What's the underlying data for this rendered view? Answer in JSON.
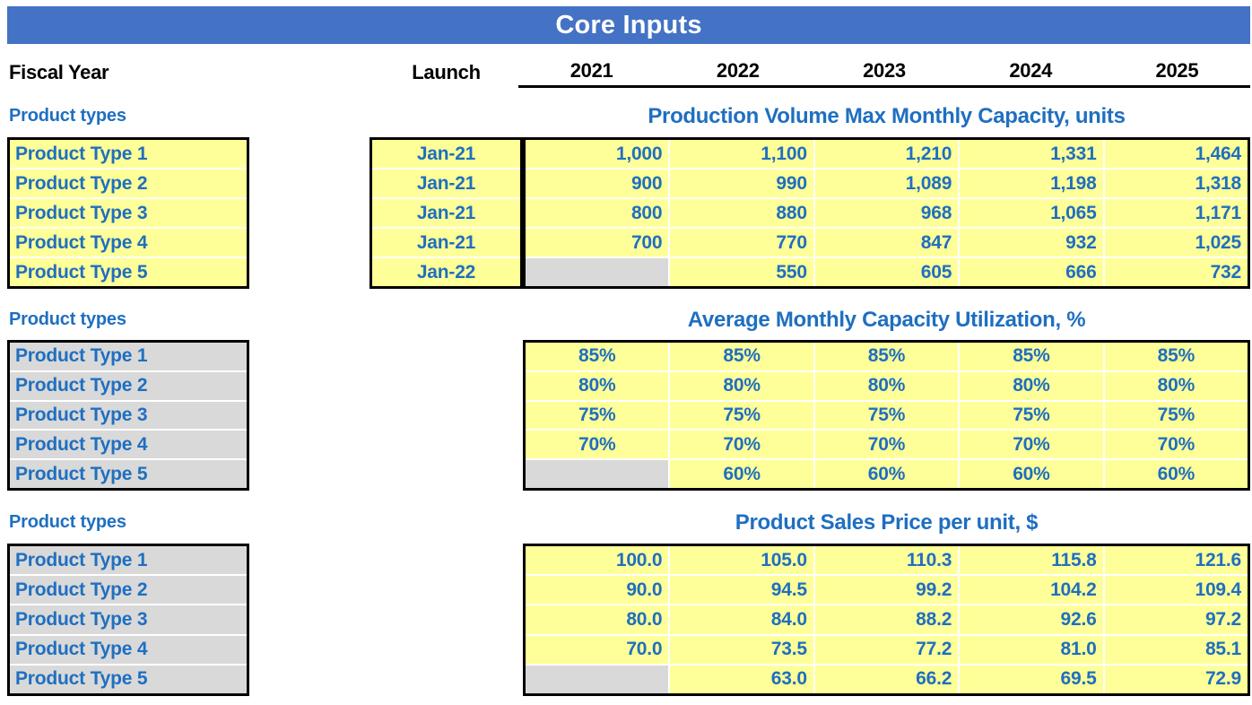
{
  "banner": {
    "title": "Core Inputs"
  },
  "header": {
    "fiscal_year_label": "Fiscal Year",
    "launch_label": "Launch",
    "years": [
      "2021",
      "2022",
      "2023",
      "2024",
      "2025"
    ]
  },
  "colors": {
    "banner_blue": "#4472C4",
    "text_blue": "#1F6FC0",
    "input_yellow": "#FFFF99",
    "locked_gray": "#D9D9D9"
  },
  "product_types": [
    "Product Type 1",
    "Product Type 2",
    "Product Type 3",
    "Product Type 4",
    "Product Type 5"
  ],
  "sections": [
    {
      "left_title": "Product types",
      "title": "Production Volume Max Monthly Capacity, units",
      "names_fill": "yellow",
      "align": "right",
      "launch": [
        "Jan-21",
        "Jan-21",
        "Jan-21",
        "Jan-21",
        "Jan-22"
      ],
      "rows": [
        [
          "1,000",
          "1,100",
          "1,210",
          "1,331",
          "1,464"
        ],
        [
          "900",
          "990",
          "1,089",
          "1,198",
          "1,318"
        ],
        [
          "800",
          "880",
          "968",
          "1,065",
          "1,171"
        ],
        [
          "700",
          "770",
          "847",
          "932",
          "1,025"
        ],
        [
          "",
          "550",
          "605",
          "666",
          "732"
        ]
      ],
      "blank_cells": [
        [
          4,
          0
        ]
      ]
    },
    {
      "left_title": "Product types",
      "title": "Average Monthly Capacity Utilization, %",
      "names_fill": "gray",
      "align": "center",
      "launch": null,
      "rows": [
        [
          "85%",
          "85%",
          "85%",
          "85%",
          "85%"
        ],
        [
          "80%",
          "80%",
          "80%",
          "80%",
          "80%"
        ],
        [
          "75%",
          "75%",
          "75%",
          "75%",
          "75%"
        ],
        [
          "70%",
          "70%",
          "70%",
          "70%",
          "70%"
        ],
        [
          "",
          "60%",
          "60%",
          "60%",
          "60%"
        ]
      ],
      "blank_cells": [
        [
          4,
          0
        ]
      ]
    },
    {
      "left_title": "Product types",
      "title": "Product Sales Price per unit, $",
      "names_fill": "gray",
      "align": "right",
      "launch": null,
      "rows": [
        [
          "100.0",
          "105.0",
          "110.3",
          "115.8",
          "121.6"
        ],
        [
          "90.0",
          "94.5",
          "99.2",
          "104.2",
          "109.4"
        ],
        [
          "80.0",
          "84.0",
          "88.2",
          "92.6",
          "97.2"
        ],
        [
          "70.0",
          "73.5",
          "77.2",
          "81.0",
          "85.1"
        ],
        [
          "",
          "63.0",
          "66.2",
          "69.5",
          "72.9"
        ]
      ],
      "blank_cells": [
        [
          4,
          0
        ]
      ]
    }
  ]
}
